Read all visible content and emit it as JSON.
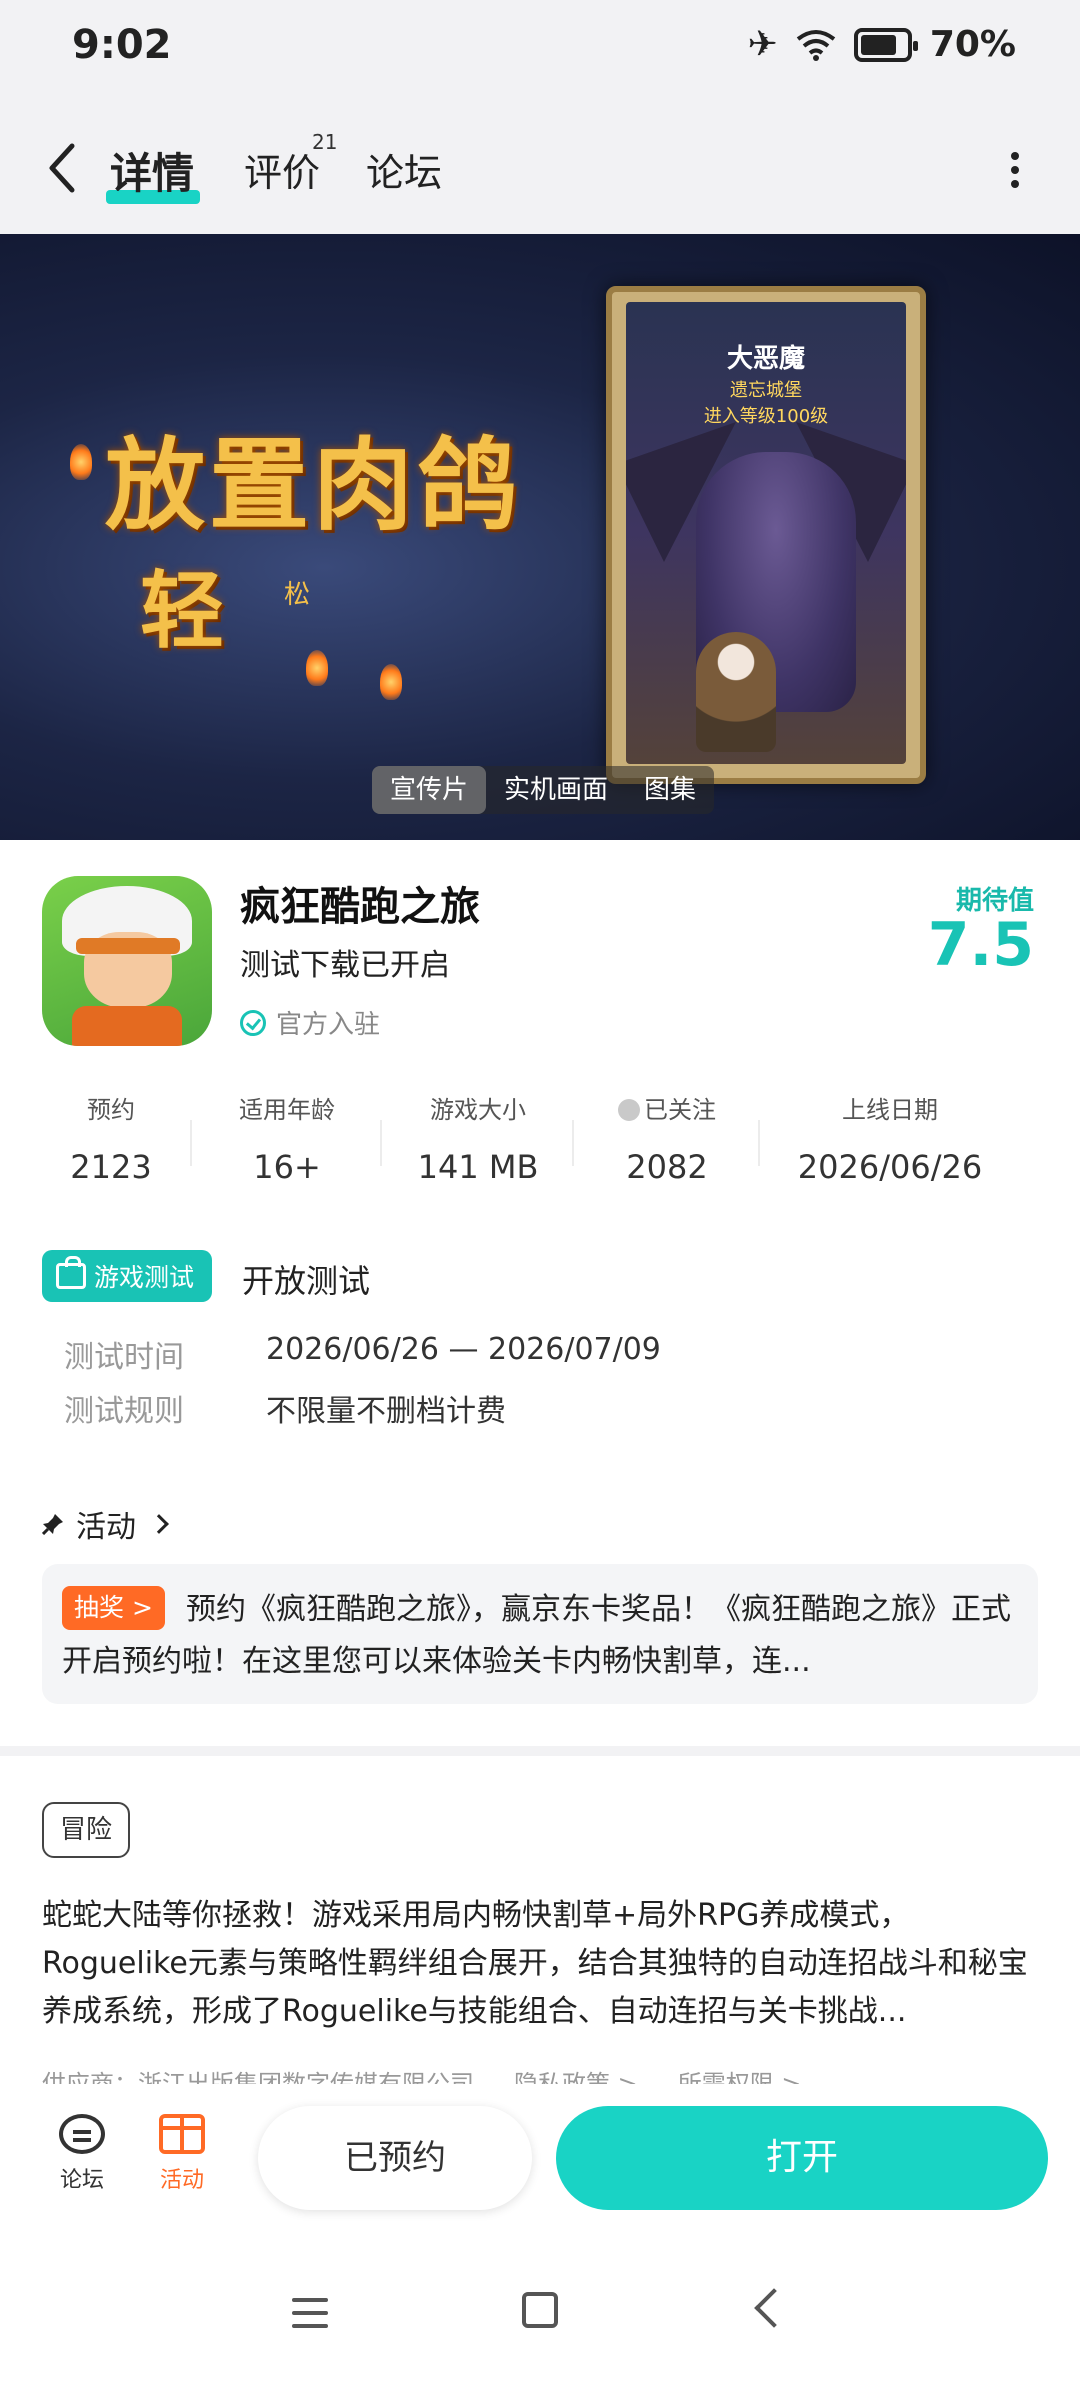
{
  "status_bar": {
    "time": "9:02",
    "battery": "70%"
  },
  "nav": {
    "tabs": [
      {
        "label": "详情",
        "active": true
      },
      {
        "label": "评价",
        "badge": "21"
      },
      {
        "label": "论坛"
      }
    ]
  },
  "banner": {
    "title": "放置肉鸽",
    "subtitle": "轻",
    "subtitle_small": "松",
    "card": {
      "title": "大恶魔",
      "line1": "遗忘城堡",
      "line2": "进入等级100级"
    },
    "media_tabs": [
      {
        "label": "宣传片",
        "active": true
      },
      {
        "label": "实机画面"
      },
      {
        "label": "图集"
      }
    ]
  },
  "app": {
    "name": "疯狂酷跑之旅",
    "status": "测试下载已开启",
    "official": "官方入驻",
    "expect_label": "期待值",
    "expect_score": "7.5"
  },
  "stats": [
    {
      "label": "预约",
      "value": "2123"
    },
    {
      "label": "适用年龄",
      "value": "16+"
    },
    {
      "label": "游戏大小",
      "value": "141 MB"
    },
    {
      "label": "已关注",
      "value": "2082"
    },
    {
      "label": "上线日期",
      "value": "2026/06/26"
    }
  ],
  "test": {
    "badge": "游戏测试",
    "title": "开放测试",
    "time_label": "测试时间",
    "time_value": "2026/06/26 — 2026/07/09",
    "rule_label": "测试规则",
    "rule_value": "不限量不删档计费"
  },
  "activity": {
    "heading": "活动",
    "tag": "抽奖 >",
    "text": "预约《疯狂酷跑之旅》，赢京东卡奖品！《疯狂酷跑之旅》正式开启预约啦！在这里您可以来体验关卡内畅快割草，连..."
  },
  "genre_tag": "冒险",
  "description": "蛇蛇大陆等你拯救！游戏采用局内畅快割草+局外RPG养成模式，Roguelike元素与策略性羁绊组合展开，结合其独特的自动连招战斗和秘宝养成系统，形成了Roguelike与技能组合、自动连招与关卡挑战...",
  "meta": {
    "provider": "供应商：浙江出版集团数字传媒有限公司",
    "privacy": "隐私政策 >",
    "permissions": "所需权限 >"
  },
  "bottom": {
    "forum": "论坛",
    "activity": "活动",
    "reserved": "已预约",
    "open": "打开"
  },
  "colors": {
    "accent": "#19d3c5",
    "orange": "#ff6a25"
  }
}
